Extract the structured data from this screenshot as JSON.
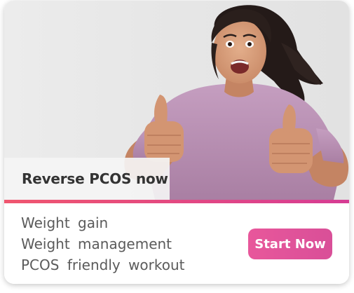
{
  "banner": {
    "tagline": "Reverse PCOS now",
    "image_subject": "excited woman giving two thumbs up",
    "features": [
      "Weight gain",
      "Weight management",
      "PCOS friendly workout"
    ],
    "cta_label": "Start Now"
  },
  "colors": {
    "accent_start": "#f0566f",
    "accent_end": "#d63c94",
    "cta_start": "#e8579b",
    "cta_end": "#d94f98",
    "text_dark": "#333333",
    "text_muted": "#5b5b5b",
    "hero_bg": "#e6e6e6",
    "shirt": "#b98fb1",
    "skin": "#d59a77",
    "hair": "#2a1f1c"
  }
}
